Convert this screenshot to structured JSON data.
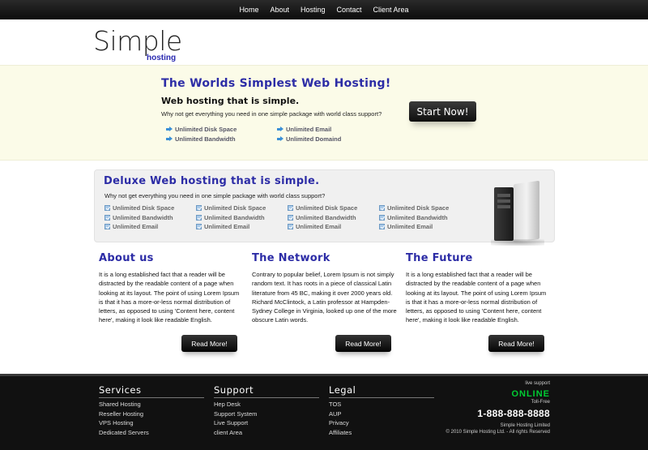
{
  "nav": {
    "items": [
      "Home",
      "About",
      "Hosting",
      "Contact",
      "Client Area"
    ]
  },
  "logo": {
    "main": "Simple",
    "sub": "hosting"
  },
  "hero": {
    "title": "The Worlds Simplest Web Hosting!",
    "subtitle": "Web hosting that is simple.",
    "desc": "Why not get everything you need in one simple package with world class support?",
    "features": [
      "Unlimited Disk Space",
      "Unlimited Bandwidth",
      "Unlimited Email",
      "Unlimited Domaind"
    ],
    "cta": "Start Now!"
  },
  "deluxe": {
    "title": "Deluxe Web hosting that is simple.",
    "desc": "Why not get everything you need in one simple package with world class support?",
    "columns": [
      [
        "Unlimited Disk Space",
        "Unlimited Bandwidth",
        "Unlimited Email"
      ],
      [
        "Unlimited Disk Space",
        "Unlimited Bandwidth",
        "Unlimited Email"
      ],
      [
        "Unlimited Disk Space",
        "Unlimited Bandwidth",
        "Unlimited Email"
      ],
      [
        "Unlimited Disk Space",
        "Unlimited Bandwidth",
        "Unlimited Email"
      ]
    ]
  },
  "sections": [
    {
      "title": "About us",
      "body": "It is a long established fact that a reader will be distracted by the readable content of a page when looking at its layout. The point of using Lorem Ipsum is that it has a more-or-less normal distribution of letters, as opposed to using 'Content here, content here', making it look like readable English.",
      "button": "Read More!"
    },
    {
      "title": "The Network",
      "body": "Contrary to popular belief, Lorem Ipsum is not simply random text. It has roots in a piece of classical Latin literature from 45 BC, making it over 2000 years old. Richard McClintock, a Latin professor at Hampden-Sydney College in Virginia, looked up one of the more obscure Latin words.",
      "button": "Read More!"
    },
    {
      "title": "The Future",
      "body": "It is a long established fact that a reader will be distracted by the readable content of a page when looking at its layout. The point of using Lorem Ipsum is that it has a more-or-less normal distribution of letters, as opposed to using 'Content here, content here', making it look like readable English.",
      "button": "Read More!"
    }
  ],
  "footer": {
    "columns": [
      {
        "title": "Services",
        "links": [
          "Shared Hosting",
          "Reseller Hosting",
          "VPS Hosting",
          "Dedicated Servers"
        ]
      },
      {
        "title": "Support",
        "links": [
          "Hep Desk",
          "Support System",
          "Live Support",
          "client Area"
        ]
      },
      {
        "title": "Legal",
        "links": [
          "TOS",
          "AUP",
          "Privacy",
          "Affiliates"
        ]
      }
    ],
    "live_support": "live support",
    "status": "ONLINE",
    "toll_free": "Toll-Free",
    "phone": "1-888-888-8888",
    "company": "Simple Hosting Limited",
    "copyright": "© 2010 Simple Hosting Ltd. - All rights Reserved"
  },
  "colors": {
    "accent": "#2c2ca6",
    "online": "#00cc33",
    "hero_bg": "#fbfbe8",
    "footer_bg": "#111111"
  }
}
